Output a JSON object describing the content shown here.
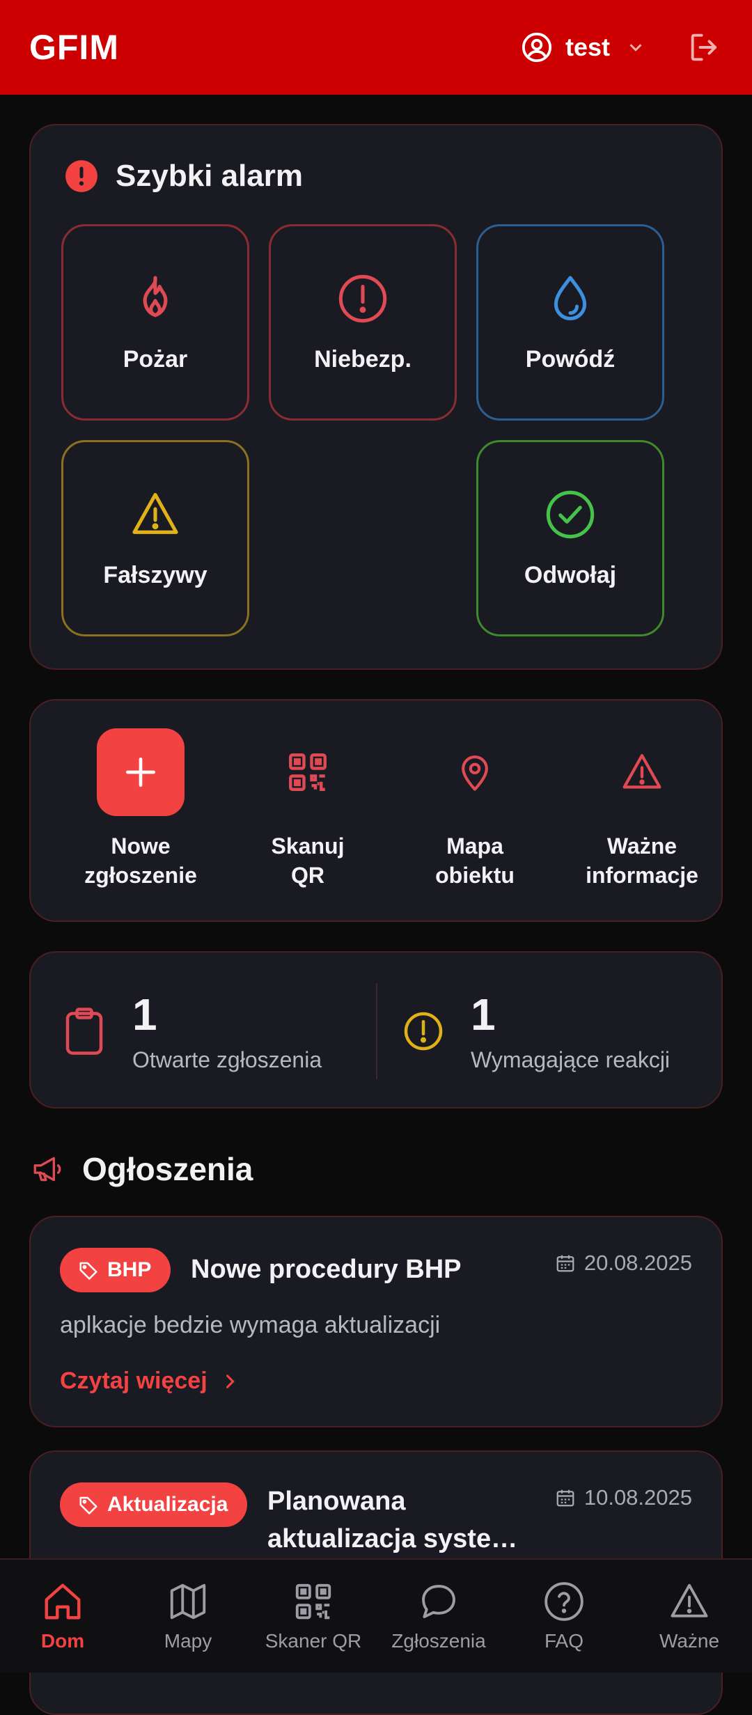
{
  "header": {
    "logo": "GFIM",
    "username": "test"
  },
  "quick_alarm": {
    "title": "Szybki alarm",
    "tiles": [
      {
        "label": "Pożar",
        "color": "#e04a55"
      },
      {
        "label": "Niebezp.",
        "color": "#e04a55"
      },
      {
        "label": "Powódź",
        "color": "#3d8fe0"
      },
      {
        "label": "Fałszywy",
        "color": "#e0b21a"
      },
      {
        "label": "Odwołaj",
        "color": "#45c24a"
      }
    ]
  },
  "actions": [
    {
      "label": "Nowe\nzgłoszenie",
      "icon": "plus-icon"
    },
    {
      "label": "Skanuj\nQR",
      "icon": "qr-icon"
    },
    {
      "label": "Mapa\nobiektu",
      "icon": "map-pin-icon"
    },
    {
      "label": "Ważne\ninformacje",
      "icon": "warning-icon"
    }
  ],
  "stats": {
    "open": {
      "value": "1",
      "label": "Otwarte zgłoszenia"
    },
    "action_needed": {
      "value": "1",
      "label": "Wymagające reakcji"
    }
  },
  "announcements": {
    "title": "Ogłoszenia",
    "items": [
      {
        "badge": "BHP",
        "title": "Nowe procedury BHP",
        "date": "20.08.2025",
        "body": "aplkacje bedzie wymaga aktualizacji",
        "more": "Czytaj więcej"
      },
      {
        "badge": "Aktualizacja",
        "title_line1": "Planowana",
        "title_line2": "aktualizacja syste…",
        "date": "10.08.2025"
      }
    ]
  },
  "bottom_nav": [
    {
      "label": "Dom",
      "active": true
    },
    {
      "label": "Mapy"
    },
    {
      "label": "Skaner QR"
    },
    {
      "label": "Zgłoszenia"
    },
    {
      "label": "FAQ"
    },
    {
      "label": "Ważne"
    }
  ],
  "colors": {
    "brand": "#cc0000",
    "accent": "#f24242",
    "background": "#0b0b0c",
    "card": "#1a1b22"
  }
}
